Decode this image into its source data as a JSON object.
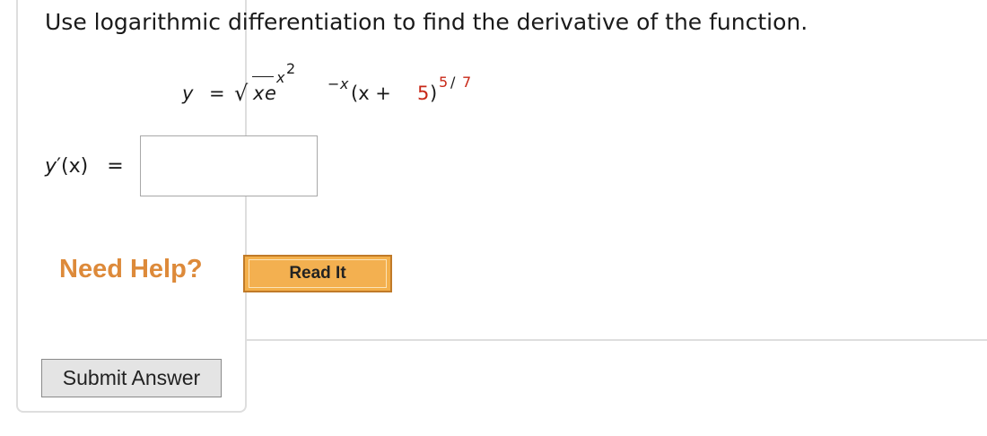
{
  "question": {
    "prompt": "Use logarithmic differentiation to find the derivative of the function.",
    "equation": {
      "lhs": "y",
      "equals": "=",
      "radical": "√",
      "radicand": "x",
      "base": "e",
      "exp_var": "x",
      "exp_power": "2",
      "exp_minus": "−",
      "exp_tail": "x",
      "paren_open": "(x +",
      "constant": "5",
      "paren_close": ")",
      "outer_exp_num": "5",
      "outer_exp_slash": "/",
      "outer_exp_den": "7"
    }
  },
  "answer": {
    "label_var": "y",
    "label_rest": "′(x)",
    "equals": "=",
    "value": "",
    "placeholder": ""
  },
  "help": {
    "need_help": "Need Help?",
    "read_it": "Read It"
  },
  "actions": {
    "submit": "Submit Answer"
  },
  "colors": {
    "need_help": "#dd8a3a",
    "read_it_bg": "#f4b04b",
    "highlight_red": "#c82818"
  }
}
